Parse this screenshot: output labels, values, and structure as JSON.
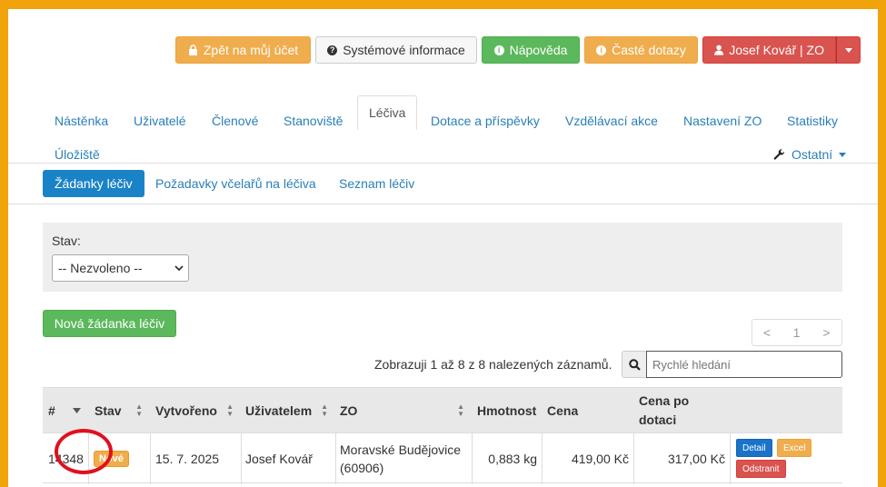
{
  "topbar": {
    "back_label": "Zpět na můj účet",
    "sysinfo_label": "Systémové informace",
    "help_label": "Nápověda",
    "faq_label": "Časté dotazy",
    "user_label": "Josef Kovář | ZO"
  },
  "nav": {
    "items": [
      {
        "label": "Nástěnka"
      },
      {
        "label": "Uživatelé"
      },
      {
        "label": "Členové"
      },
      {
        "label": "Stanoviště"
      },
      {
        "label": "Léčiva",
        "active": true
      },
      {
        "label": "Dotace a příspěvky"
      },
      {
        "label": "Vzdělávací akce"
      },
      {
        "label": "Nastavení ZO"
      },
      {
        "label": "Statistiky"
      },
      {
        "label": "Úložiště"
      }
    ],
    "other_label": "Ostatní"
  },
  "subnav": {
    "items": [
      {
        "label": "Žádanky léčiv",
        "active": true
      },
      {
        "label": "Požadavky včelařů na léčiva"
      },
      {
        "label": "Seznam léčiv"
      }
    ]
  },
  "filter": {
    "status_label": "Stav:",
    "status_selected": "-- Nezvoleno --"
  },
  "actions": {
    "new_request_label": "Nová žádanka léčiv"
  },
  "pager": {
    "prev": "<",
    "current": "1",
    "next": ">"
  },
  "results_text": "Zobrazuji 1 až 8 z 8 nalezených záznamů.",
  "search": {
    "placeholder": "Rychlé hledání"
  },
  "table": {
    "columns": [
      "#",
      "Stav",
      "Vytvořeno",
      "Uživatelem",
      "ZO",
      "Hmotnost",
      "Cena",
      "Cena po dotaci"
    ],
    "rows": [
      {
        "id": "14348",
        "status": "Nové",
        "created": "15. 7. 2025",
        "user": "Josef Kovář",
        "zo_line1": "Moravské Budějovice",
        "zo_line2": "(60906)",
        "weight": "0,883 kg",
        "price": "419,00 Kč",
        "price_after": "317,00 Kč",
        "buttons": {
          "detail": "Detail",
          "excel": "Excel",
          "remove": "Odstranit"
        }
      }
    ]
  },
  "colors": {
    "frame": "#f0a30a",
    "link": "#2a7fb8",
    "warning": "#f0ad4e",
    "success": "#5cb85c",
    "danger": "#d9534f",
    "primary": "#1a83c7",
    "highlight_circle": "#e0101c"
  }
}
